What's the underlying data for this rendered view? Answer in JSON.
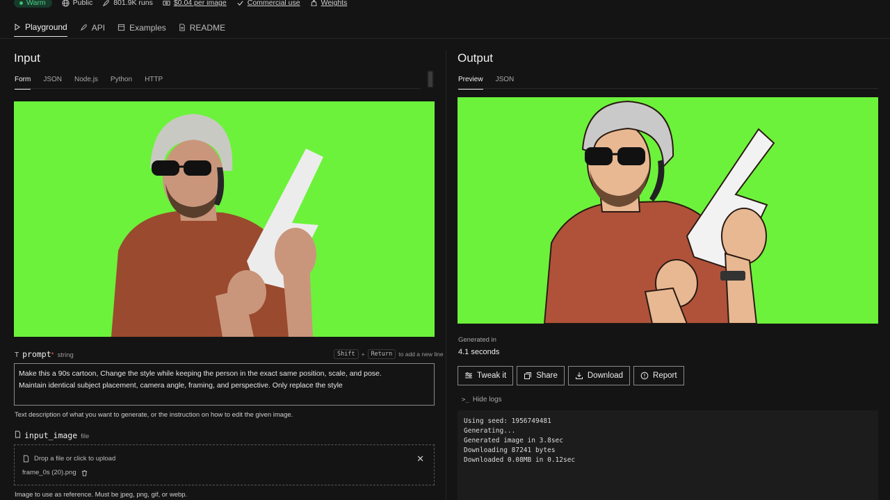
{
  "meta": {
    "status": "Warm",
    "visibility": "Public",
    "runs": "801.9K runs",
    "price": "$0.04 per image",
    "license": "Commercial use",
    "weights": "Weights"
  },
  "tabs": [
    {
      "label": "Playground",
      "icon": "play-icon",
      "active": true
    },
    {
      "label": "API",
      "icon": "rocket-icon"
    },
    {
      "label": "Examples",
      "icon": "examples-icon"
    },
    {
      "label": "README",
      "icon": "document-icon"
    }
  ],
  "input": {
    "heading": "Input",
    "subtabs": [
      "Form",
      "JSON",
      "Node.js",
      "Python",
      "HTTP"
    ],
    "prompt": {
      "name": "prompt",
      "required_mark": "*",
      "type": "string",
      "hint_key1": "Shift",
      "hint_plus": "+",
      "hint_key2": "Return",
      "hint_text": "to add a new line",
      "value_line1": "Make this a 90s cartoon, Change the style while keeping the person in the exact same position, scale, and pose.",
      "value_line2": "Maintain identical subject placement, camera angle, framing, and perspective. Only replace the style",
      "description": "Text description of what you want to generate, or the instruction on how to edit the given image."
    },
    "input_image": {
      "name": "input_image",
      "type": "file",
      "drop_text": "Drop a file or click to upload",
      "filename": "frame_0s (20).png",
      "description": "Image to use as reference. Must be jpeg, png, gif, or webp."
    }
  },
  "output": {
    "heading": "Output",
    "subtabs": [
      "Preview",
      "JSON"
    ],
    "generated_label": "Generated in",
    "generated_value": "4.1 seconds",
    "buttons": [
      "Tweak it",
      "Share",
      "Download",
      "Report"
    ],
    "hide_logs": "Hide logs",
    "logs": [
      "Using seed: 1956749481",
      "Generating...",
      "Generated image in 3.8sec",
      "Downloading 87241 bytes",
      "Downloaded 0.08MB in 0.12sec"
    ]
  },
  "colors": {
    "accent_green": "#36c46f",
    "greenscreen": "#6cf23b",
    "background": "#141414"
  }
}
